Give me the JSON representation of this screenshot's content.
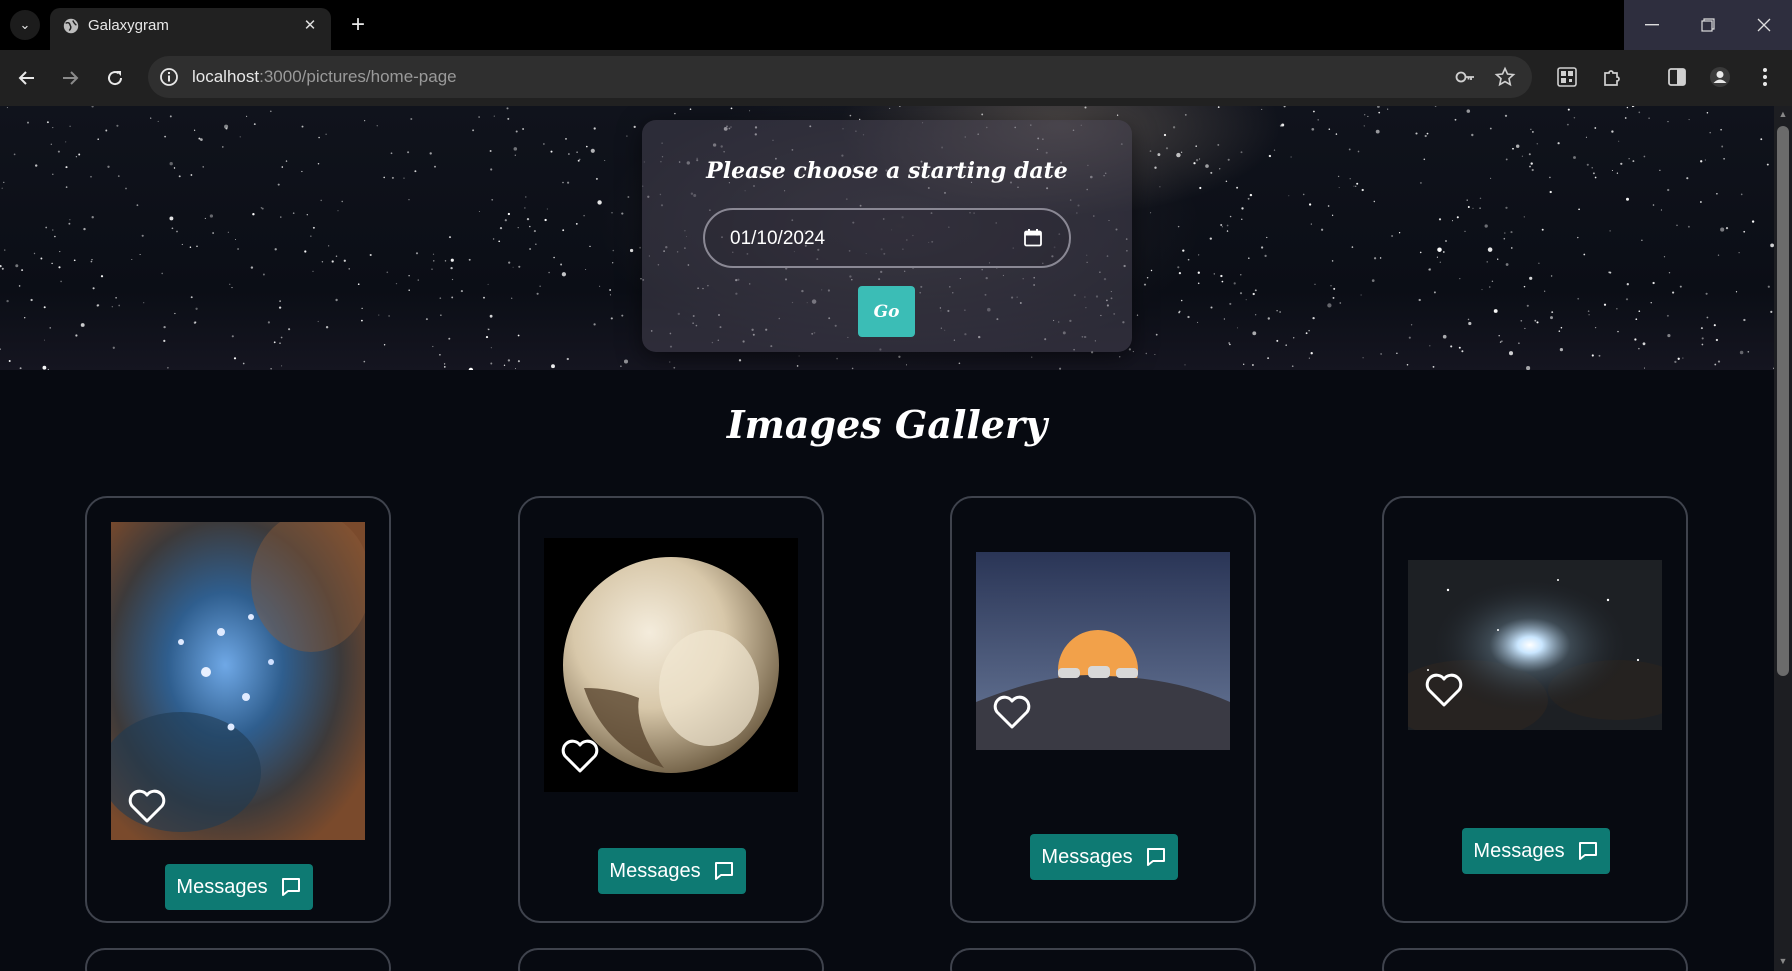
{
  "browser": {
    "tab_title": "Galaxygram",
    "url_host": "localhost",
    "url_path": ":3000/pictures/home-page"
  },
  "hero": {
    "prompt": "Please choose a starting date",
    "date_value": "01/10/2024",
    "go_label": "Go"
  },
  "gallery": {
    "title": "Images Gallery",
    "cards": [
      {
        "image_name": "pleiades-nebula",
        "button_label": "Messages"
      },
      {
        "image_name": "pluto",
        "button_label": "Messages"
      },
      {
        "image_name": "moonrise-observatory",
        "button_label": "Messages"
      },
      {
        "image_name": "galaxy-star-field",
        "button_label": "Messages"
      }
    ]
  },
  "colors": {
    "accent_teal": "#3bbdb6",
    "button_teal": "#0e7a73",
    "page_bg": "#070a11"
  }
}
